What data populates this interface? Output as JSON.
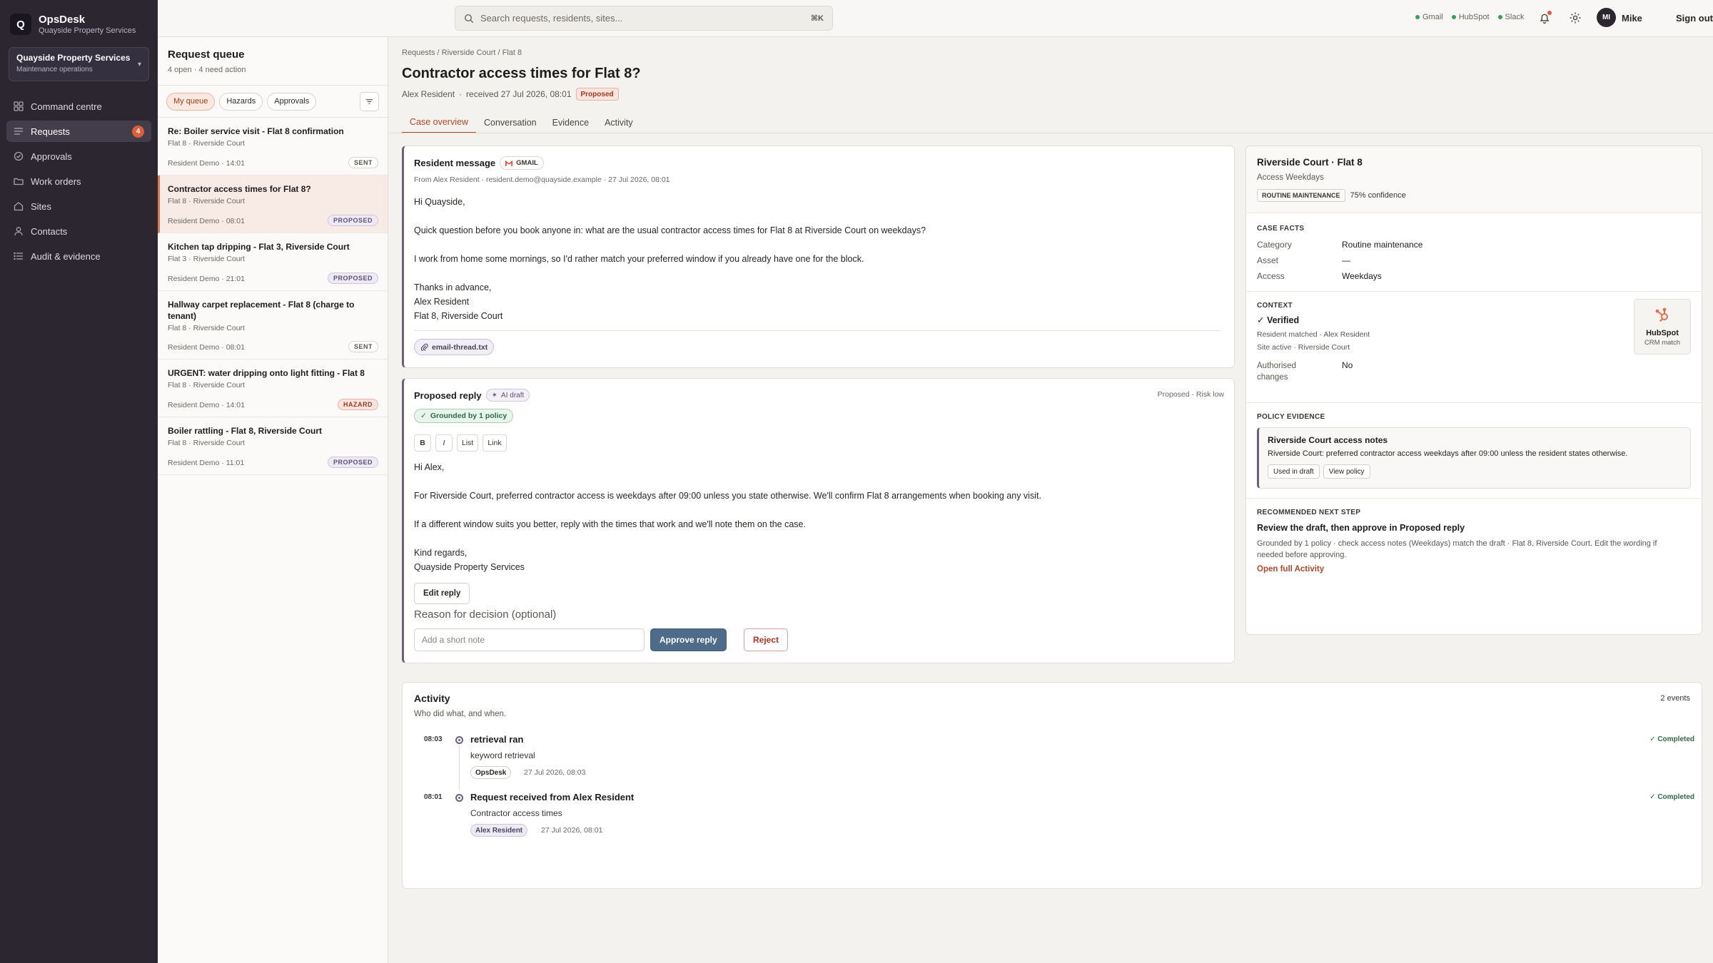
{
  "brand": {
    "logo": "Q",
    "name": "OpsDesk",
    "sub": "Quayside Property Services"
  },
  "org": {
    "name": "Quayside Property Services",
    "sub": "Maintenance operations"
  },
  "nav": [
    {
      "label": "Command centre",
      "icon": "grid-icon"
    },
    {
      "label": "Requests",
      "icon": "list-icon",
      "badge": "4",
      "active": true
    },
    {
      "label": "Approvals",
      "icon": "check-shield-icon"
    },
    {
      "label": "Work orders",
      "icon": "folder-icon"
    },
    {
      "label": "Sites",
      "icon": "home-icon"
    },
    {
      "label": "Contacts",
      "icon": "person-icon"
    },
    {
      "label": "Audit & evidence",
      "icon": "audit-list-icon"
    }
  ],
  "topbar": {
    "search_placeholder": "Search requests, residents, sites...",
    "shortcut": "⌘K",
    "integrations": [
      "Gmail",
      "HubSpot",
      "Slack"
    ],
    "avatar": "MI",
    "user": "Mike",
    "signout": "Sign out"
  },
  "queue": {
    "title": "Request queue",
    "sub": "4 open · 4 need action",
    "filters": [
      "My queue",
      "Hazards",
      "Approvals"
    ],
    "items": [
      {
        "title": "Re: Boiler service visit - Flat 8 confirmation",
        "loc": "Flat 8 · Riverside Court",
        "meta": "Resident Demo · 14:01",
        "badge": "SENT"
      },
      {
        "title": "Contractor access times for Flat 8?",
        "loc": "Flat 8 · Riverside Court",
        "meta": "Resident Demo · 08:01",
        "badge": "PROPOSED"
      },
      {
        "title": "Kitchen tap dripping - Flat 3, Riverside Court",
        "loc": "Flat 3 · Riverside Court",
        "meta": "Resident Demo · 21:01",
        "badge": "PROPOSED"
      },
      {
        "title": "Hallway carpet replacement - Flat 8 (charge to tenant)",
        "loc": "Flat 8 · Riverside Court",
        "meta": "Resident Demo · 08:01",
        "badge": "SENT"
      },
      {
        "title": "URGENT: water dripping onto light fitting - Flat 8",
        "loc": "Flat 8 · Riverside Court",
        "meta": "Resident Demo · 14:01",
        "badge": "HAZARD"
      },
      {
        "title": "Boiler rattling - Flat 8, Riverside Court",
        "loc": "Flat 8 · Riverside Court",
        "meta": "Resident Demo · 11:01",
        "badge": "PROPOSED"
      }
    ]
  },
  "case": {
    "breadcrumb": "Requests / Riverside Court / Flat 8",
    "title": "Contractor access times for Flat 8?",
    "resident": "Alex Resident",
    "received": "received 27 Jul 2026, 08:01",
    "status": "Proposed",
    "tabs": [
      "Case overview",
      "Conversation",
      "Evidence",
      "Activity"
    ]
  },
  "message": {
    "heading": "Resident message",
    "source": "GMAIL",
    "from": "From Alex Resident · resident.demo@quayside.example · 27 Jul 2026, 08:01",
    "lines": [
      "Hi Quayside,",
      "Quick question before you book anyone in: what are the usual contractor access times for Flat 8 at Riverside Court on weekdays?",
      "I work from home some mornings, so I'd rather match your preferred window if you already have one for the block.",
      "Thanks in advance,",
      "Alex Resident",
      "Flat 8, Riverside Court"
    ],
    "attachment": "email-thread.txt"
  },
  "reply": {
    "heading": "Proposed reply",
    "ai_tag": "AI draft",
    "grounded": "Grounded by 1 policy",
    "status_right": "Proposed · Risk low",
    "format": [
      "B",
      "I",
      "List",
      "Link"
    ],
    "lines": [
      "Hi Alex,",
      "For Riverside Court, preferred contractor access is weekdays after 09:00 unless you state otherwise. We'll confirm Flat 8 arrangements when booking any visit.",
      "If a different window suits you better, reply with the times that work and we'll note them on the case.",
      "Kind regards,",
      "Quayside Property Services"
    ],
    "edit": "Edit reply",
    "reason_label": "Reason for decision (optional)",
    "note_placeholder": "Add a short note",
    "approve": "Approve reply",
    "reject": "Reject"
  },
  "side": {
    "title": "Riverside Court · Flat 8",
    "access": "Access Weekdays",
    "tag": "ROUTINE MAINTENANCE",
    "confidence": "75% confidence",
    "facts_label": "CASE FACTS",
    "facts": [
      {
        "k": "Category",
        "v": "Routine maintenance"
      },
      {
        "k": "Asset",
        "v": "—"
      },
      {
        "k": "Access",
        "v": "Weekdays"
      }
    ],
    "context_label": "CONTEXT",
    "verified": "✓ Verified",
    "matched": "Resident matched · Alex Resident",
    "site": "Site active · Riverside Court",
    "auth_k": "Authorised changes",
    "auth_v": "No",
    "hub_name": "HubSpot",
    "hub_sub": "CRM match",
    "policy_label": "POLICY EVIDENCE",
    "policy_title": "Riverside Court access notes",
    "policy_text": "Riverside Court: preferred contractor access weekdays after 09:00 unless the resident states otherwise.",
    "policy_btn1": "Used in draft",
    "policy_btn2": "View policy",
    "next_label": "RECOMMENDED NEXT STEP",
    "next_title": "Review the draft, then approve in Proposed reply",
    "next_text": "Grounded by 1 policy · check access notes (Weekdays) match the draft · Flat 8, Riverside Court. Edit the wording if needed before approving.",
    "next_link": "Open full Activity"
  },
  "activity": {
    "heading": "Activity",
    "sub": "Who did what, and when.",
    "count": "2 events",
    "events": [
      {
        "time": "08:03",
        "title": "retrieval ran",
        "sub": "keyword retrieval",
        "actor": "OpsDesk",
        "date": "27 Jul 2026, 08:03",
        "status": "✓ Completed"
      },
      {
        "time": "08:01",
        "title": "Request received from Alex Resident",
        "sub": "Contractor access times",
        "actor": "Alex Resident",
        "date": "27 Jul 2026, 08:01",
        "status": "✓ Completed"
      }
    ]
  }
}
